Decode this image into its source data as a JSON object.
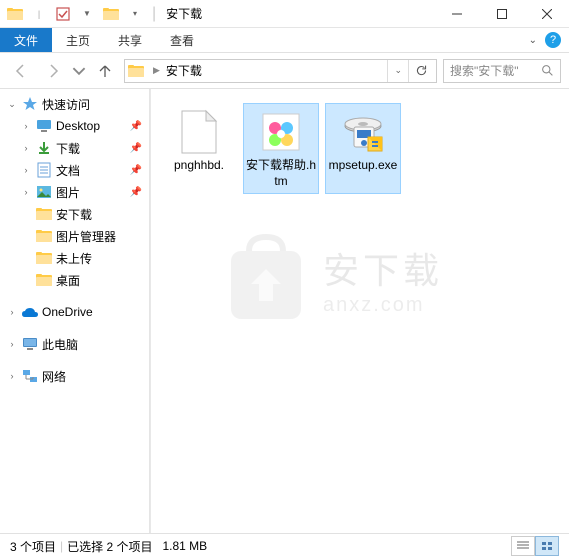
{
  "title": "安下载",
  "ribbon": {
    "file": "文件",
    "home": "主页",
    "share": "共享",
    "view": "查看"
  },
  "breadcrumb": {
    "location": "安下载"
  },
  "search": {
    "placeholder": "搜索\"安下载\""
  },
  "sidebar": {
    "quickaccess": "快速访问",
    "items": [
      {
        "label": "Desktop",
        "pinned": true,
        "icon": "desktop"
      },
      {
        "label": "下载",
        "pinned": true,
        "icon": "downloads"
      },
      {
        "label": "文档",
        "pinned": true,
        "icon": "documents"
      },
      {
        "label": "图片",
        "pinned": true,
        "icon": "pictures"
      },
      {
        "label": "安下载",
        "pinned": false,
        "icon": "folder"
      },
      {
        "label": "图片管理器",
        "pinned": false,
        "icon": "folder"
      },
      {
        "label": "未上传",
        "pinned": false,
        "icon": "folder"
      },
      {
        "label": "桌面",
        "pinned": false,
        "icon": "folder"
      }
    ],
    "onedrive": "OneDrive",
    "thispc": "此电脑",
    "network": "网络"
  },
  "files": [
    {
      "name": "pnghhbd.",
      "selected": false,
      "type": "blank"
    },
    {
      "name": "安下载帮助.htm",
      "selected": true,
      "type": "htm"
    },
    {
      "name": "mpsetup.exe",
      "selected": true,
      "type": "exe"
    }
  ],
  "status": {
    "count": "3 个项目",
    "selected": "已选择 2 个项目",
    "size": "1.81 MB"
  },
  "watermark": {
    "line1": "安下载",
    "line2": "anxz.com"
  }
}
